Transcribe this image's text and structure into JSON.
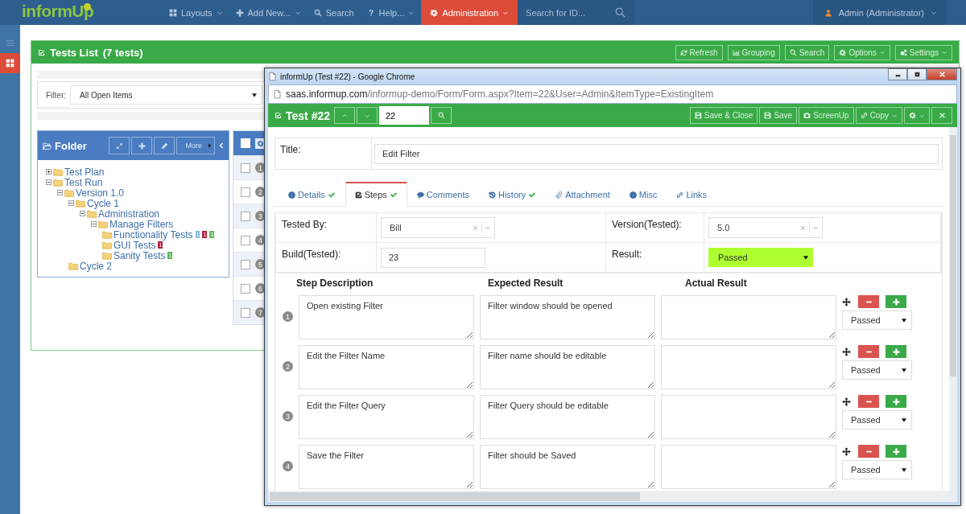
{
  "nav": {
    "logo": "informUp",
    "items": [
      {
        "label": "Layouts",
        "caret": true,
        "selected": false
      },
      {
        "label": "Add New...",
        "caret": true,
        "selected": false
      },
      {
        "label": "Search",
        "caret": false,
        "selected": false
      },
      {
        "label": "Help...",
        "caret": true,
        "selected": false
      },
      {
        "label": "Administration",
        "caret": true,
        "selected": true
      }
    ],
    "search": {
      "placeholder": "Search for ID..."
    },
    "user": "Admin (Administrator)"
  },
  "sidebar": {
    "items": [
      {
        "selected": false
      },
      {
        "selected": true
      }
    ]
  },
  "panel": {
    "title": "Tests List",
    "count": "(7 tests)",
    "buttons": [
      {
        "label": "Refresh",
        "caret": false
      },
      {
        "label": "Grouping",
        "caret": false
      },
      {
        "label": "Search",
        "caret": false
      },
      {
        "label": "Options",
        "caret": true
      },
      {
        "label": "Settings",
        "caret": true
      }
    ]
  },
  "filter": {
    "label": "Filter:",
    "value": "All Open Items"
  },
  "folder": {
    "title": "Folder",
    "more": "More",
    "tree": [
      {
        "label": "Test Plan",
        "expanded": false
      },
      {
        "label": "Test Run",
        "expanded": true,
        "children": [
          {
            "label": "Version 1.0",
            "expanded": true,
            "children": [
              {
                "label": "Cycle 1",
                "expanded": true,
                "children": [
                  {
                    "label": "Administration",
                    "expanded": true,
                    "children": [
                      {
                        "label": "Manage Filters",
                        "expanded": true,
                        "children": [
                          {
                            "label": "Functionality Tests",
                            "badges": [
                              {
                                "text": "1",
                                "color": "#7fb8d8"
                              },
                              {
                                "text": "1",
                                "color": "#b0233a"
                              },
                              {
                                "text": "3",
                                "color": "#5cb85c"
                              }
                            ]
                          },
                          {
                            "label": "GUI Tests",
                            "badges": [
                              {
                                "text": "1",
                                "color": "#b0233a"
                              }
                            ]
                          },
                          {
                            "label": "Sanity Tests",
                            "badges": [
                              {
                                "text": "1",
                                "color": "#5cb85c"
                              }
                            ]
                          }
                        ]
                      }
                    ]
                  }
                ]
              },
              {
                "label": "Cycle 2"
              }
            ]
          }
        ]
      }
    ]
  },
  "list": {
    "all_checked": false,
    "rows": [
      {
        "number": "1",
        "checked": false
      },
      {
        "number": "2",
        "checked": false
      },
      {
        "number": "3",
        "checked": false
      },
      {
        "number": "4",
        "checked": false
      },
      {
        "number": "5",
        "checked": false
      },
      {
        "number": "6",
        "checked": false
      },
      {
        "number": "7",
        "checked": false
      }
    ]
  },
  "popup": {
    "window_title": "informUp (Test #22) - Google Chrome",
    "url_host": "saas.informup.com",
    "url_path": "/informup-demo/Form/Form.aspx?Item=22&User=Admin&ItemType=ExistingItem",
    "title": "Test #22",
    "item_number": "22",
    "buttons": [
      {
        "label": "Save & Close",
        "caret": false
      },
      {
        "label": "Save",
        "caret": false
      },
      {
        "label": "ScreenUp",
        "caret": false
      },
      {
        "label": "Copy",
        "caret": true
      }
    ],
    "title_label": "Title:",
    "title_value": "Edit Filter",
    "tabs": [
      {
        "label": "Details",
        "checked": true,
        "selected": false
      },
      {
        "label": "Steps",
        "checked": true,
        "selected": true
      },
      {
        "label": "Comments",
        "checked": false,
        "selected": false
      },
      {
        "label": "History",
        "checked": true,
        "selected": false
      },
      {
        "label": "Attachment",
        "checked": false,
        "selected": false
      },
      {
        "label": "Misc",
        "checked": false,
        "selected": false
      },
      {
        "label": "Links",
        "checked": false,
        "selected": false
      }
    ],
    "fields": [
      {
        "label": "Tested By:",
        "value": "Bill",
        "kind": "combo"
      },
      {
        "label": "Version(Tested):",
        "value": "5.0",
        "kind": "combo"
      },
      {
        "label": "Build(Tested):",
        "value": "23",
        "kind": "text"
      },
      {
        "label": "Result:",
        "value": "Passed",
        "kind": "select",
        "color": "#adff2f"
      }
    ],
    "step_columns": [
      "Step Description",
      "Expected Result",
      "Actual Result"
    ],
    "steps": [
      {
        "number": "1",
        "description": "Open existing Filter",
        "expected": "Filter window should be opened",
        "result": "Passed"
      },
      {
        "number": "2",
        "description": "Edit the Filter Name",
        "expected": "Filter name should be editable",
        "result": "Passed"
      },
      {
        "number": "3",
        "description": "Edit the Filter Query",
        "expected": "Filter Query should be editable",
        "result": "Passed"
      },
      {
        "number": "4",
        "description": "Save the Filter",
        "expected": "Filter should be Saved",
        "result": "Passed"
      }
    ]
  }
}
